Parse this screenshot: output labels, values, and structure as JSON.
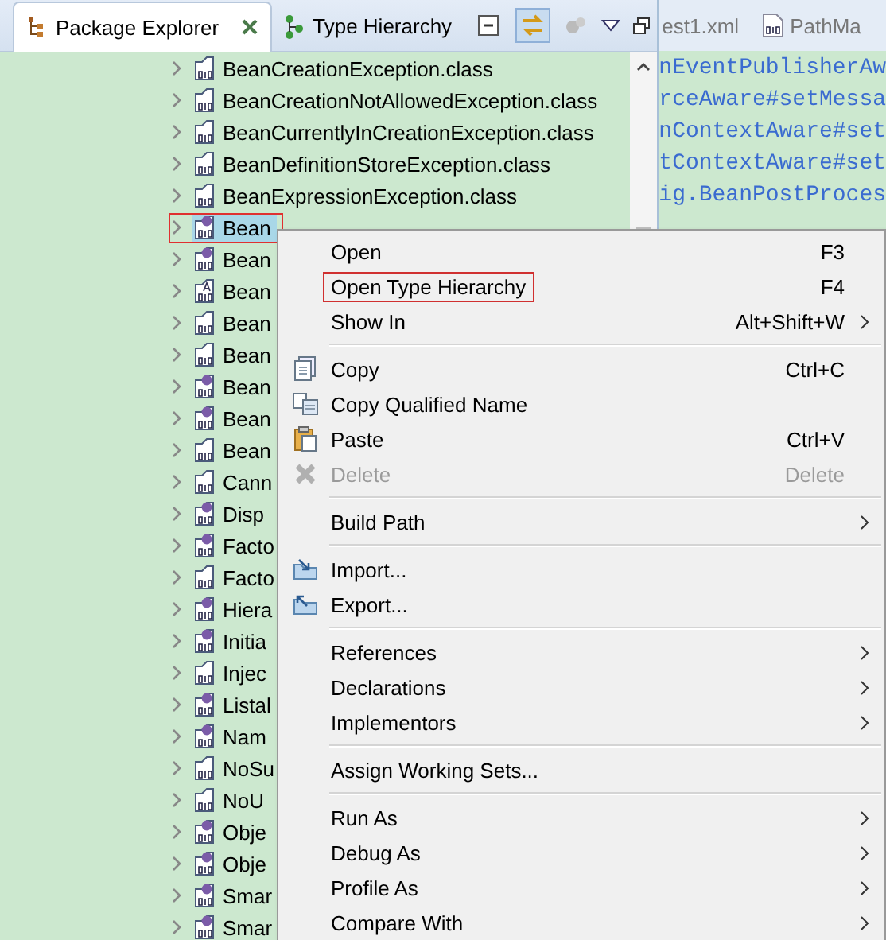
{
  "view_tabs": [
    {
      "label": "Package Explorer",
      "kind": "explorer",
      "selected": true
    },
    {
      "label": "Type Hierarchy",
      "kind": "hierarchy",
      "selected": false
    }
  ],
  "editor_tabs": [
    {
      "label": "est1.xml",
      "kind": "xml"
    },
    {
      "label": "PathMa",
      "kind": "class"
    }
  ],
  "tree": [
    {
      "label": "BeanCreationException.class",
      "kind": "class",
      "selected": false,
      "boxed": false
    },
    {
      "label": "BeanCreationNotAllowedException.class",
      "kind": "class",
      "selected": false,
      "boxed": false
    },
    {
      "label": "BeanCurrentlyInCreationException.class",
      "kind": "class",
      "selected": false,
      "boxed": false
    },
    {
      "label": "BeanDefinitionStoreException.class",
      "kind": "class",
      "selected": false,
      "boxed": false
    },
    {
      "label": "BeanExpressionException.class",
      "kind": "class",
      "selected": false,
      "boxed": false
    },
    {
      "label": "Bean",
      "kind": "interface",
      "selected": true,
      "boxed": true
    },
    {
      "label": "Bean",
      "kind": "interface",
      "selected": false,
      "boxed": false
    },
    {
      "label": "Bean",
      "kind": "annotation",
      "selected": false,
      "boxed": false
    },
    {
      "label": "Bean",
      "kind": "class",
      "selected": false,
      "boxed": false
    },
    {
      "label": "Bean",
      "kind": "class",
      "selected": false,
      "boxed": false
    },
    {
      "label": "Bean",
      "kind": "interface",
      "selected": false,
      "boxed": false
    },
    {
      "label": "Bean",
      "kind": "interface",
      "selected": false,
      "boxed": false
    },
    {
      "label": "Bean",
      "kind": "class",
      "selected": false,
      "boxed": false
    },
    {
      "label": "Cann",
      "kind": "class",
      "selected": false,
      "boxed": false
    },
    {
      "label": "Disp",
      "kind": "interface",
      "selected": false,
      "boxed": false
    },
    {
      "label": "Facto",
      "kind": "interface",
      "selected": false,
      "boxed": false
    },
    {
      "label": "Facto",
      "kind": "class",
      "selected": false,
      "boxed": false
    },
    {
      "label": "Hiera",
      "kind": "interface",
      "selected": false,
      "boxed": false
    },
    {
      "label": "Initia",
      "kind": "interface",
      "selected": false,
      "boxed": false
    },
    {
      "label": "Injec",
      "kind": "class",
      "selected": false,
      "boxed": false
    },
    {
      "label": "Listal",
      "kind": "interface",
      "selected": false,
      "boxed": false
    },
    {
      "label": "Nam",
      "kind": "interface",
      "selected": false,
      "boxed": false
    },
    {
      "label": "NoSu",
      "kind": "class",
      "selected": false,
      "boxed": false
    },
    {
      "label": "NoU",
      "kind": "class",
      "selected": false,
      "boxed": false
    },
    {
      "label": "Obje",
      "kind": "interface",
      "selected": false,
      "boxed": false
    },
    {
      "label": "Obje",
      "kind": "interface",
      "selected": false,
      "boxed": false
    },
    {
      "label": "Smar",
      "kind": "interface",
      "selected": false,
      "boxed": false
    },
    {
      "label": "Smar",
      "kind": "interface",
      "selected": false,
      "boxed": false
    }
  ],
  "code_lines": [
    "nEventPublisherAw",
    "rceAware#setMessa",
    "nContextAware#set",
    "tContextAware#set",
    "ig.BeanPostProces"
  ],
  "context_menu": [
    [
      {
        "label": "Open",
        "shortcut": "F3",
        "submenu": false,
        "disabled": false,
        "boxed": false
      },
      {
        "label": "Open Type Hierarchy",
        "shortcut": "F4",
        "submenu": false,
        "disabled": false,
        "boxed": true
      },
      {
        "label": "Show In",
        "shortcut": "Alt+Shift+W",
        "submenu": true,
        "disabled": false,
        "boxed": false
      }
    ],
    [
      {
        "label": "Copy",
        "shortcut": "Ctrl+C",
        "submenu": false,
        "disabled": false,
        "boxed": false
      },
      {
        "label": "Copy Qualified Name",
        "submenu": false,
        "disabled": false,
        "boxed": false
      },
      {
        "label": "Paste",
        "shortcut": "Ctrl+V",
        "submenu": false,
        "disabled": false,
        "boxed": false
      },
      {
        "label": "Delete",
        "shortcut": "Delete",
        "submenu": false,
        "disabled": true,
        "boxed": false
      }
    ],
    [
      {
        "label": "Build Path",
        "submenu": true,
        "disabled": false,
        "boxed": false
      }
    ],
    [
      {
        "label": "Import...",
        "submenu": false,
        "disabled": false,
        "boxed": false
      },
      {
        "label": "Export...",
        "submenu": false,
        "disabled": false,
        "boxed": false
      }
    ],
    [
      {
        "label": "References",
        "submenu": true,
        "disabled": false,
        "boxed": false
      },
      {
        "label": "Declarations",
        "submenu": true,
        "disabled": false,
        "boxed": false
      },
      {
        "label": "Implementors",
        "submenu": true,
        "disabled": false,
        "boxed": false
      }
    ],
    [
      {
        "label": "Assign Working Sets...",
        "submenu": false,
        "disabled": false,
        "boxed": false
      }
    ],
    [
      {
        "label": "Run As",
        "submenu": true,
        "disabled": false,
        "boxed": false
      },
      {
        "label": "Debug As",
        "submenu": true,
        "disabled": false,
        "boxed": false
      },
      {
        "label": "Profile As",
        "submenu": true,
        "disabled": false,
        "boxed": false
      },
      {
        "label": "Compare With",
        "submenu": true,
        "disabled": false,
        "boxed": false
      }
    ]
  ]
}
